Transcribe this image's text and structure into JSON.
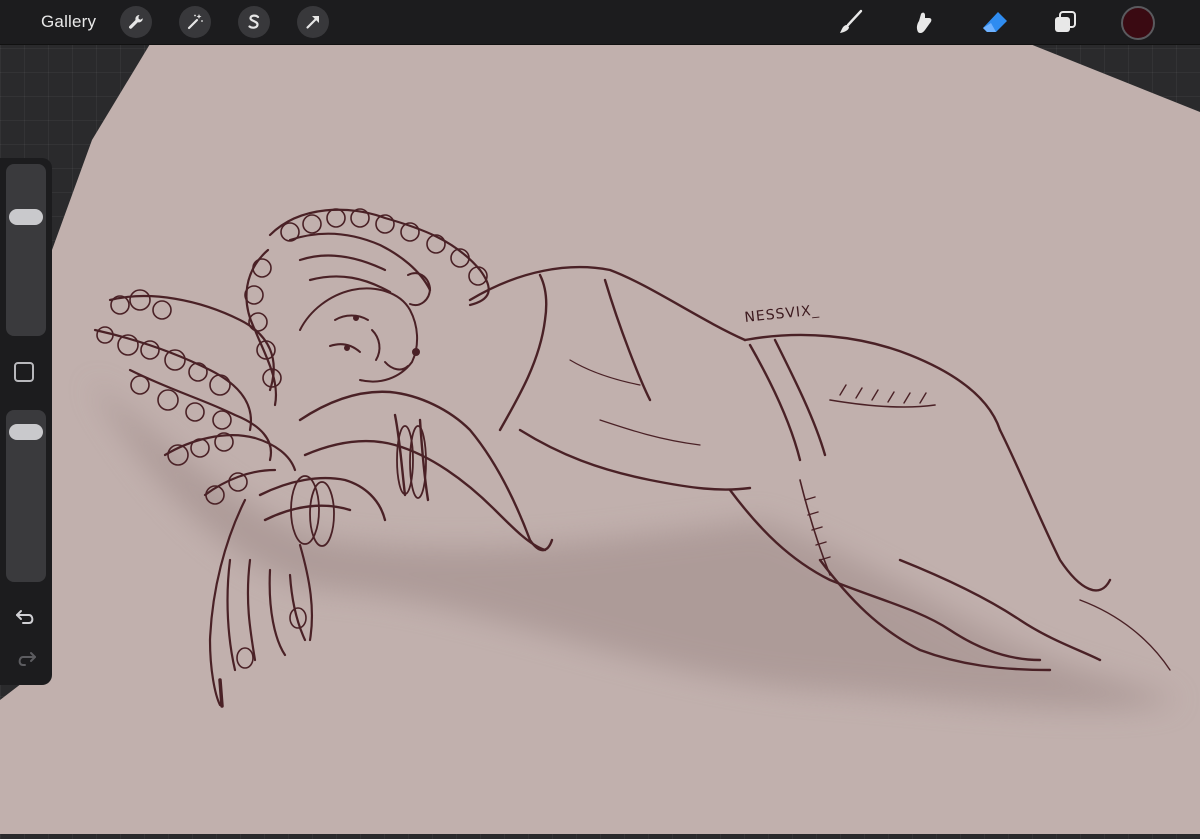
{
  "topbar": {
    "gallery_label": "Gallery",
    "left_tools": [
      "wrench-icon",
      "magic-wand-icon",
      "selection-s-icon",
      "arrow-transform-icon"
    ],
    "right_tools": [
      "brush-icon",
      "smudge-icon",
      "eraser-icon",
      "layers-icon"
    ],
    "active_tool": "eraser-icon",
    "current_color": "#3a0a12"
  },
  "sidebar": {
    "brush_size_level": 0.72,
    "opacity_level": 0.93,
    "icons": [
      "modify-square-icon",
      "undo-icon",
      "redo-icon"
    ]
  },
  "canvas": {
    "paper_color": "#c1b0ad",
    "ink_color": "#4a2126",
    "signature": "NESSVIX_"
  },
  "colors": {
    "bar": "#1c1c1e",
    "eraser_active": "#2f8cf0"
  }
}
